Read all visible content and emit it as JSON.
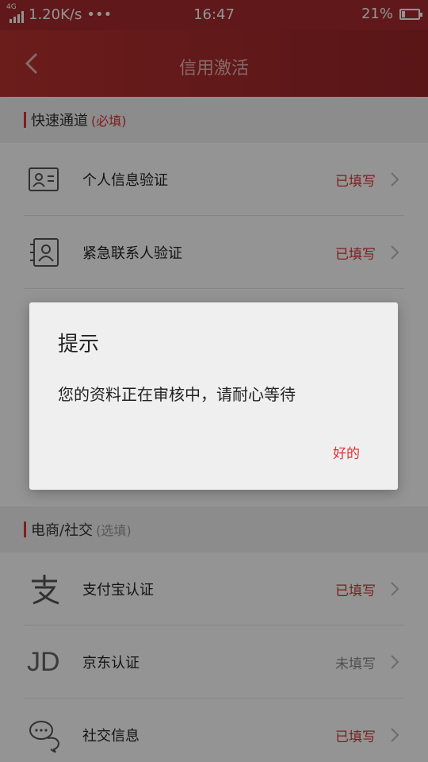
{
  "status_bar": {
    "network_type": "4G",
    "speed": "1.20K/s",
    "more": "•••",
    "time": "16:47",
    "battery_percent": "21%",
    "battery_level": 0.21
  },
  "nav": {
    "title": "信用激活"
  },
  "sections": [
    {
      "title": "快速通道",
      "tag": "(必填)",
      "items": [
        {
          "label": "个人信息验证",
          "status": "已填写"
        },
        {
          "label": "紧急联系人验证",
          "status": "已填写"
        }
      ]
    },
    {
      "title": "电商/社交",
      "tag": "(选填)",
      "items": [
        {
          "label": "支付宝认证",
          "status": "已填写"
        },
        {
          "label": "京东认证",
          "status": "未填写",
          "icon_text": "JD"
        },
        {
          "label": "社交信息",
          "status": "已填写"
        }
      ]
    }
  ],
  "dialog": {
    "title": "提示",
    "message": "您的资料正在审核中，请耐心等待",
    "ok_label": "好的"
  },
  "colors": {
    "brand_red": "#a52a2e",
    "accent_red": "#dd3333",
    "muted_gray": "#888888"
  },
  "icons": [
    "back-arrow-icon",
    "id-card-icon",
    "contact-card-icon",
    "alipay-icon",
    "jd-icon",
    "chat-icon",
    "chevron-right-icon"
  ]
}
